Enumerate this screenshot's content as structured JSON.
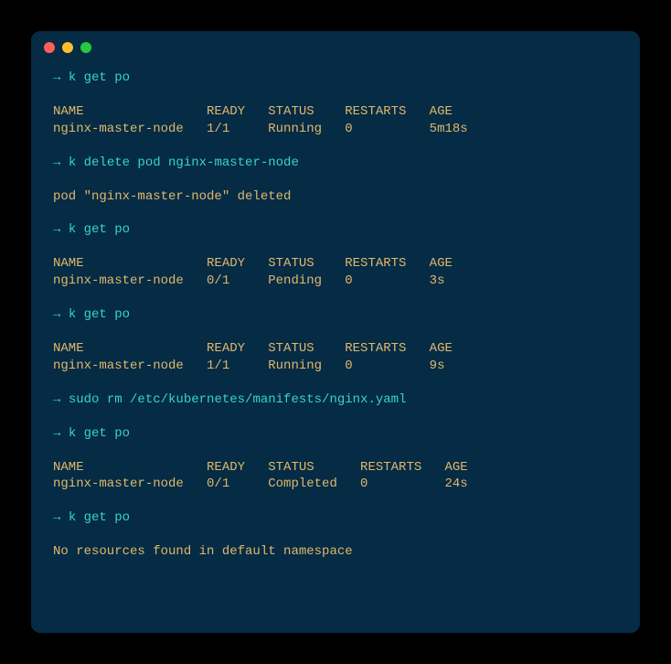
{
  "window": {
    "buttons": [
      "close",
      "minimize",
      "zoom"
    ]
  },
  "session": {
    "prompt_arrow": "→",
    "blocks": [
      {
        "type": "cmd",
        "text": "k get po"
      },
      {
        "type": "blank"
      },
      {
        "type": "table",
        "cols": [
          "NAME",
          "READY",
          "STATUS",
          "RESTARTS",
          "AGE"
        ],
        "widths": [
          20,
          8,
          10,
          11,
          8
        ],
        "rows": [
          [
            "nginx-master-node",
            "1/1",
            "Running",
            "0",
            "5m18s"
          ]
        ]
      },
      {
        "type": "blank"
      },
      {
        "type": "cmd",
        "text": "k delete pod nginx-master-node"
      },
      {
        "type": "blank"
      },
      {
        "type": "msg",
        "text": "pod \"nginx-master-node\" deleted"
      },
      {
        "type": "blank"
      },
      {
        "type": "cmd",
        "text": "k get po"
      },
      {
        "type": "blank"
      },
      {
        "type": "table",
        "cols": [
          "NAME",
          "READY",
          "STATUS",
          "RESTARTS",
          "AGE"
        ],
        "widths": [
          20,
          8,
          10,
          11,
          8
        ],
        "rows": [
          [
            "nginx-master-node",
            "0/1",
            "Pending",
            "0",
            "3s"
          ]
        ]
      },
      {
        "type": "blank"
      },
      {
        "type": "cmd",
        "text": "k get po"
      },
      {
        "type": "blank"
      },
      {
        "type": "table",
        "cols": [
          "NAME",
          "READY",
          "STATUS",
          "RESTARTS",
          "AGE"
        ],
        "widths": [
          20,
          8,
          10,
          11,
          8
        ],
        "rows": [
          [
            "nginx-master-node",
            "1/1",
            "Running",
            "0",
            "9s"
          ]
        ]
      },
      {
        "type": "blank"
      },
      {
        "type": "cmd",
        "text": "sudo rm /etc/kubernetes/manifests/nginx.yaml"
      },
      {
        "type": "blank"
      },
      {
        "type": "cmd",
        "text": "k get po"
      },
      {
        "type": "blank"
      },
      {
        "type": "table",
        "cols": [
          "NAME",
          "READY",
          "STATUS",
          "RESTARTS",
          "AGE"
        ],
        "widths": [
          20,
          8,
          12,
          11,
          8
        ],
        "rows": [
          [
            "nginx-master-node",
            "0/1",
            "Completed",
            "0",
            "24s"
          ]
        ]
      },
      {
        "type": "blank"
      },
      {
        "type": "cmd",
        "text": "k get po"
      },
      {
        "type": "blank"
      },
      {
        "type": "msg",
        "text": "No resources found in default namespace"
      }
    ]
  }
}
